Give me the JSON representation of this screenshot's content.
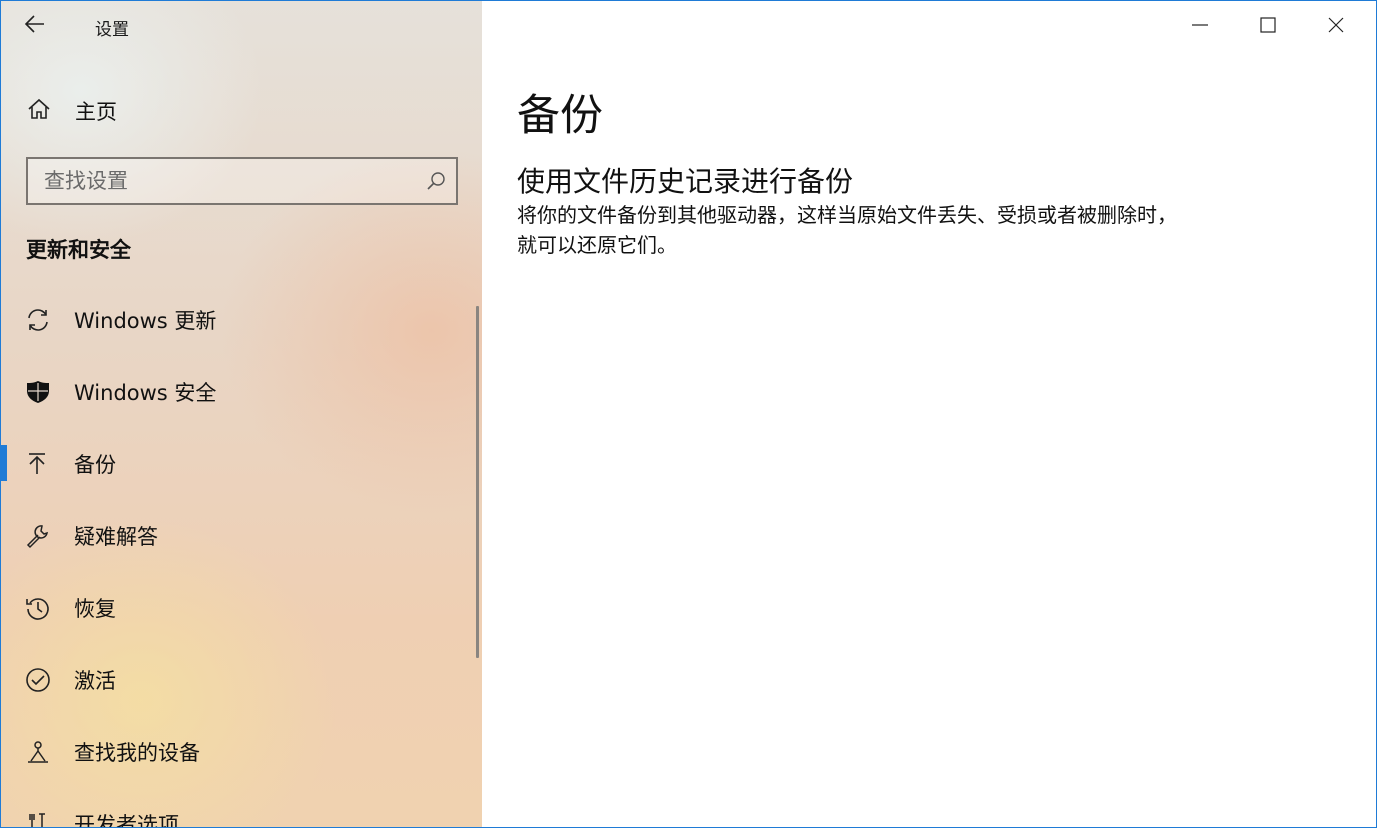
{
  "window": {
    "app_title": "设置"
  },
  "sidebar": {
    "home_label": "主页",
    "search": {
      "placeholder": "查找设置",
      "value": ""
    },
    "section_title": "更新和安全",
    "items": [
      {
        "label": "Windows 更新",
        "icon": "sync-icon",
        "selected": false
      },
      {
        "label": "Windows 安全",
        "icon": "shield-icon",
        "selected": false
      },
      {
        "label": "备份",
        "icon": "backup-arrow-icon",
        "selected": true
      },
      {
        "label": "疑难解答",
        "icon": "wrench-icon",
        "selected": false
      },
      {
        "label": "恢复",
        "icon": "history-icon",
        "selected": false
      },
      {
        "label": "激活",
        "icon": "check-circle-icon",
        "selected": false
      },
      {
        "label": "查找我的设备",
        "icon": "person-pin-icon",
        "selected": false
      },
      {
        "label": "开发者选项",
        "icon": "developer-tools-icon",
        "selected": false
      }
    ]
  },
  "main": {
    "title": "备份",
    "subtitle": "使用文件历史记录进行备份",
    "description": "将你的文件备份到其他驱动器，这样当原始文件丢失、受损或者被删除时，就可以还原它们。"
  },
  "colors": {
    "accent": "#1f7bd6",
    "text": "#111111"
  }
}
